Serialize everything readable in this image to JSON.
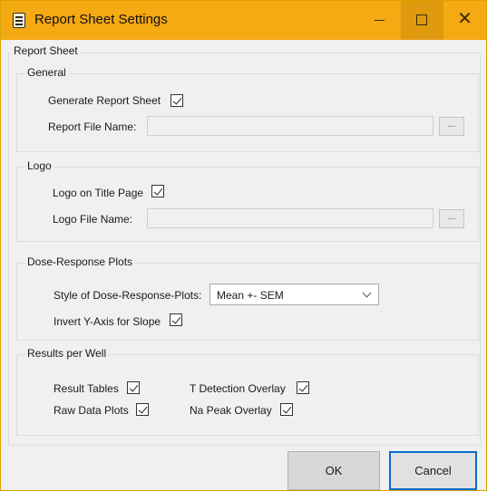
{
  "window": {
    "title": "Report Sheet Settings",
    "minimize_label": "—",
    "close_label": "✕"
  },
  "report_sheet": {
    "legend": "Report Sheet",
    "general": {
      "legend": "General",
      "generate_label": "Generate Report Sheet",
      "generate_checked": true,
      "file_name_label": "Report File Name:",
      "file_name_value": "",
      "browse_label": "..."
    },
    "logo": {
      "legend": "Logo",
      "logo_on_title_label": "Logo on Title Page",
      "logo_on_title_checked": true,
      "file_name_label": "Logo File Name:",
      "file_name_value": "",
      "browse_label": "..."
    },
    "dose_response": {
      "legend": "Dose-Response Plots",
      "style_label": "Style of Dose-Response-Plots:",
      "style_value": "Mean +- SEM",
      "invert_label": "Invert Y-Axis for Slope",
      "invert_checked": true
    },
    "results_per_well": {
      "legend": "Results per Well",
      "result_tables_label": "Result Tables",
      "result_tables_checked": true,
      "t_detection_label": "T Detection Overlay",
      "t_detection_checked": true,
      "raw_data_label": "Raw Data Plots",
      "raw_data_checked": true,
      "na_peak_label": "Na Peak Overlay",
      "na_peak_checked": true
    }
  },
  "buttons": {
    "ok_label": "OK",
    "cancel_label": "Cancel"
  },
  "colors": {
    "titlebar": "#f5a912",
    "cancel_focus": "#0a6bcd"
  }
}
